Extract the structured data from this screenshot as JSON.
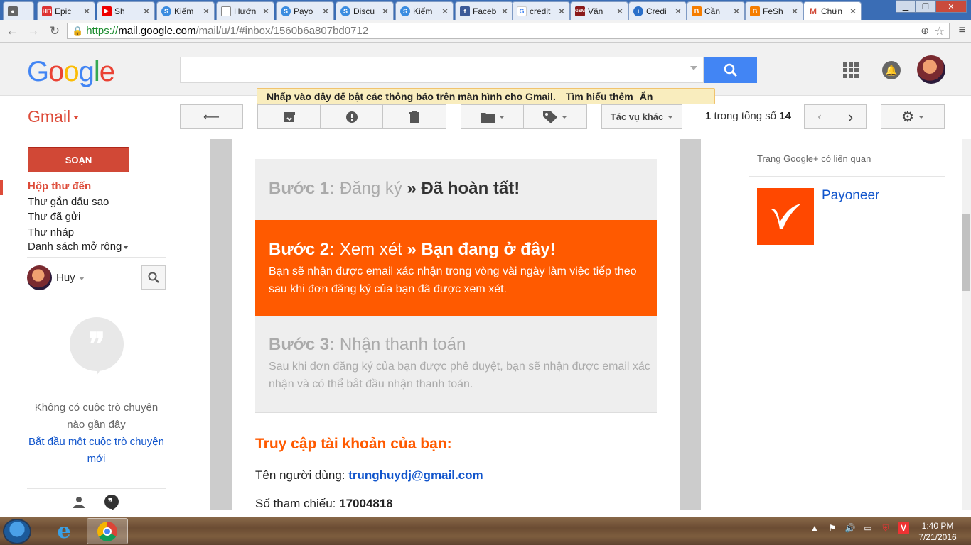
{
  "browser": {
    "tabs": [
      {
        "label": "",
        "icon": "incognito-icon"
      },
      {
        "label": "Epic",
        "icon": "hb-icon"
      },
      {
        "label": "Sh",
        "icon": "youtube-icon"
      },
      {
        "label": "Kiếm",
        "icon": "s-icon"
      },
      {
        "label": "Hướn",
        "icon": "page-icon"
      },
      {
        "label": "Payo",
        "icon": "s-icon"
      },
      {
        "label": "Discu",
        "icon": "s-icon"
      },
      {
        "label": "Kiếm",
        "icon": "s-icon"
      },
      {
        "label": "Faceb",
        "icon": "facebook-icon"
      },
      {
        "label": "credit",
        "icon": "google-icon"
      },
      {
        "label": "Văn",
        "icon": "gsm-icon"
      },
      {
        "label": "Credi",
        "icon": "info-icon"
      },
      {
        "label": "Cần",
        "icon": "blogger-icon"
      },
      {
        "label": "FeSh",
        "icon": "blogger-icon"
      },
      {
        "label": "Chứn",
        "icon": "gmail-icon"
      }
    ],
    "url_scheme": "https://",
    "url_host": "mail.google.com",
    "url_path": "/mail/u/1/#inbox/1560b6a807bd0712"
  },
  "header": {
    "logo_letters": [
      "G",
      "o",
      "o",
      "g",
      "l",
      "e"
    ],
    "search_value": ""
  },
  "notification": {
    "message": "Nhấp vào đây để bật các thông báo trên màn hình cho Gmail.",
    "learn_more": "Tìm hiểu thêm",
    "hide": "Ẩn"
  },
  "toolbar": {
    "app_label": "Gmail",
    "more_actions": "Tác vụ khác",
    "pager_current": "1",
    "pager_middle": " trong tổng số ",
    "pager_total": "14"
  },
  "sidebar": {
    "compose": "SOẠN",
    "items": [
      {
        "label": "Hộp thư đến"
      },
      {
        "label": "Thư gắn dấu sao"
      },
      {
        "label": "Thư đã gửi"
      },
      {
        "label": "Thư nháp"
      },
      {
        "label": "Danh sách mở rộng"
      }
    ],
    "hangouts_user": "Huy",
    "no_chat_text": "Không có cuộc trò chuyện nào gần đây",
    "start_chat_link": "Bắt đầu một cuộc trò chuyện mới"
  },
  "email": {
    "step1_label": "Bước 1:",
    "step1_name": "Đăng ký",
    "step1_status": "» Đã hoàn tất!",
    "step2_label": "Bước 2:",
    "step2_name": "Xem xét",
    "step2_status": "» Bạn đang ở đây!",
    "step2_desc": "Bạn sẽ nhận được email xác nhận trong vòng vài ngày làm việc tiếp theo sau khi đơn đăng ký của bạn đã được xem xét.",
    "step3_label": "Bước 3:",
    "step3_name": "Nhận thanh toán",
    "step3_desc": "Sau khi đơn đăng ký của bạn được phê duyệt, bạn sẽ nhận được email xác nhận và có thể bắt đầu nhận thanh toán.",
    "access_title": "Truy cập tài khoản của bạn:",
    "username_label": "Tên người dùng: ",
    "username_value": "trunghuydj@gmail.com",
    "ref_label": "Số tham chiếu: ",
    "ref_value": "17004818",
    "accent_color": "#ff5a00"
  },
  "right_pane": {
    "title": "Trang Google+ có liên quan",
    "page_name": "Payoneer"
  },
  "taskbar": {
    "time": "1:40 PM",
    "date": "7/21/2016"
  }
}
